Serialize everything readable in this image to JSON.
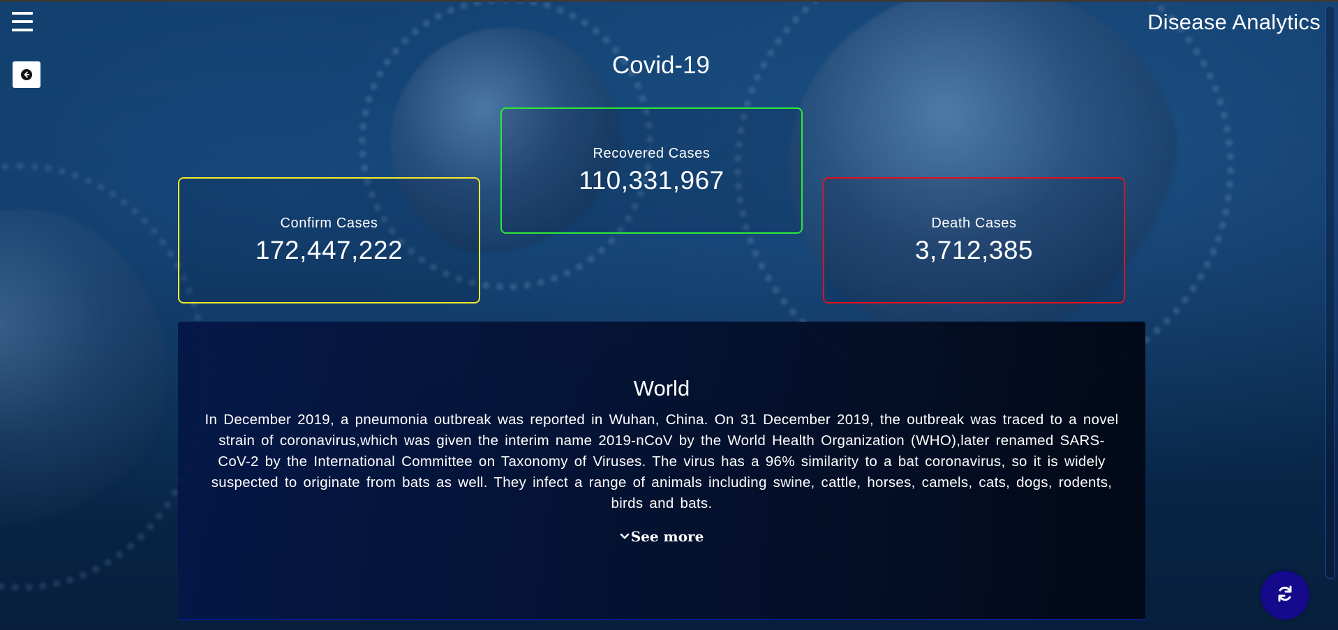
{
  "header": {
    "brand": "Disease Analytics",
    "menu_icon": "hamburger-menu-icon",
    "back_icon": "circle-arrow-left-icon"
  },
  "page": {
    "title": "Covid-19"
  },
  "stats": {
    "confirm": {
      "label": "Confirm Cases",
      "value": "172,447,222",
      "border_color": "#f5ea2a"
    },
    "recovered": {
      "label": "Recovered Cases",
      "value": "110,331,967",
      "border_color": "#2be83a"
    },
    "death": {
      "label": "Death Cases",
      "value": "3,712,385",
      "border_color": "#e0121d"
    }
  },
  "world": {
    "title": "World",
    "description": "In December 2019, a pneumonia outbreak was reported in Wuhan, China. On 31 December 2019, the outbreak was traced to a novel strain of coronavirus,which was given the interim name 2019-nCoV by the World Health Organization (WHO),later renamed SARS-CoV-2 by the International Committee on Taxonomy of Viruses. The virus has a 96% similarity to a bat coronavirus, so it is widely suspected to originate from bats as well. They infect a range of animals including swine, cattle, horses, camels, cats, dogs, rodents, birds and bats.",
    "see_more_label": "See more",
    "see_more_icon": "chevron-down-icon"
  },
  "actions": {
    "refresh_icon": "refresh-icon",
    "refresh_color": "#150a8c"
  }
}
